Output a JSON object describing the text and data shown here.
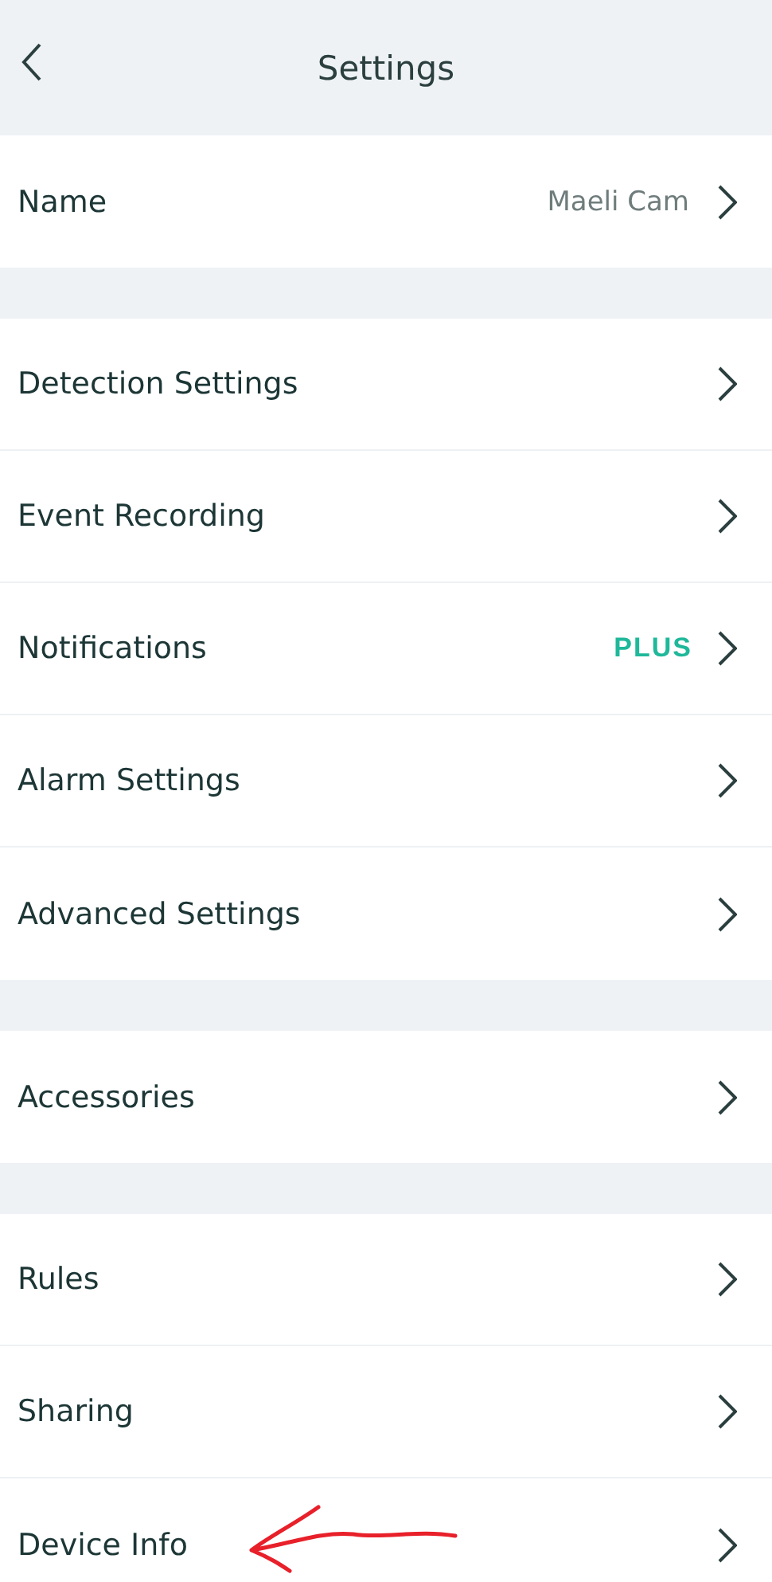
{
  "header": {
    "title": "Settings"
  },
  "groups": [
    {
      "rows": [
        {
          "label": "Name",
          "value": "Maeli Cam"
        }
      ]
    },
    {
      "rows": [
        {
          "label": "Detection Settings"
        },
        {
          "label": "Event Recording"
        },
        {
          "label": "Notifications",
          "badge": "PLUS"
        },
        {
          "label": "Alarm Settings"
        },
        {
          "label": "Advanced Settings"
        }
      ]
    },
    {
      "rows": [
        {
          "label": "Accessories"
        }
      ]
    },
    {
      "rows": [
        {
          "label": "Rules"
        },
        {
          "label": "Sharing"
        },
        {
          "label": "Device Info",
          "annotated": true
        }
      ]
    }
  ]
}
